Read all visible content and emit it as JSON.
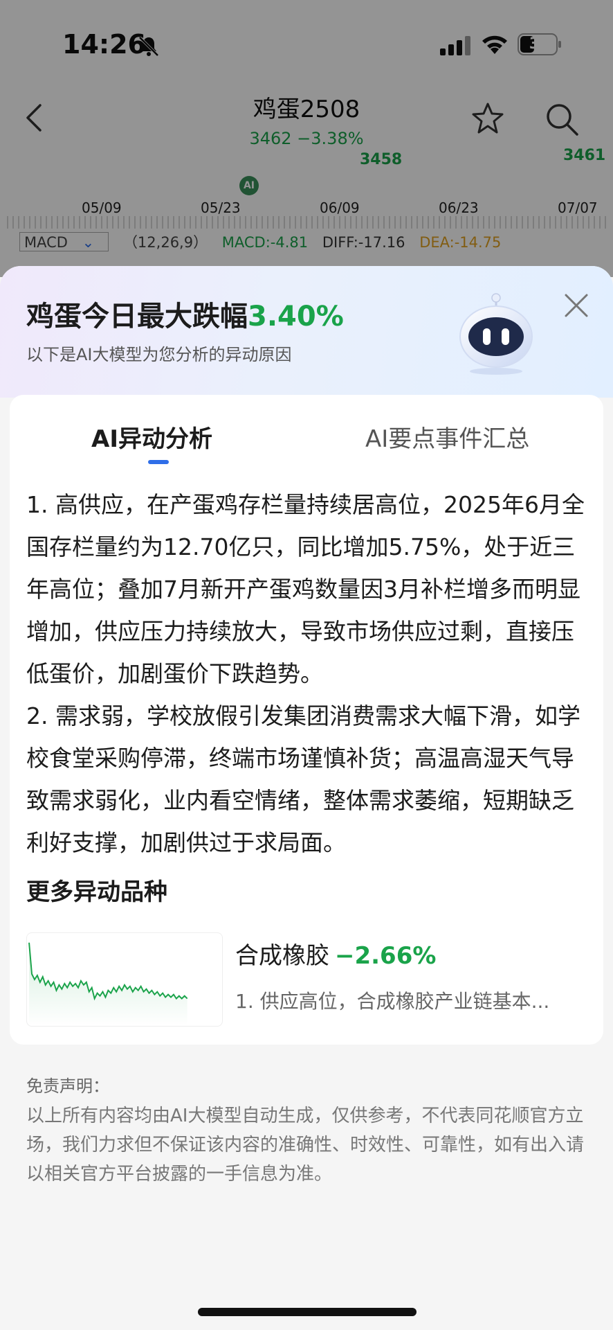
{
  "status_bar": {
    "time": "14:26",
    "battery": "34"
  },
  "nav": {
    "title": "鸡蛋2508",
    "price_line": "3462 −3.38%"
  },
  "chart_bg": {
    "value_left": "3458",
    "value_right": "3461",
    "ai_marker": "AI",
    "dates": [
      "05/09",
      "05/23",
      "06/09",
      "06/23",
      "07/07"
    ],
    "macd": {
      "selector": "MACD",
      "params": "（12,26,9）",
      "macd": "MACD:-4.81",
      "diff": "DIFF:-17.16",
      "dea": "DEA:-14.75"
    }
  },
  "sheet": {
    "title_prefix": "鸡蛋今日最大跌幅",
    "title_pct": "3.40%",
    "subtitle": "以下是AI大模型为您分析的异动原因",
    "tabs": [
      "AI异动分析",
      "AI要点事件汇总"
    ],
    "analysis": [
      "1. 高供应，在产蛋鸡存栏量持续居高位，2025年6月全国存栏量约为12.70亿只，同比增加5.75%，处于近三年高位；叠加7月新开产蛋鸡数量因3月补栏增多而明显增加，供应压力持续放大，导致市场供应过剩，直接压低蛋价，加剧蛋价下跌趋势。",
      "2. 需求弱，学校放假引发集团消费需求大幅下滑，如学校食堂采购停滞，终端市场谨慎补货；高温高湿天气导致需求弱化，业内看空情绪，整体需求萎缩，短期缺乏利好支撑，加剧供过于求局面。"
    ],
    "more_title": "更多异动品种",
    "more_item": {
      "name": "合成橡胶",
      "pct": "−2.66%",
      "desc": "1. 供应高位，合成橡胶产业链基本..."
    },
    "disclaimer_title": "免责声明：",
    "disclaimer_body": "以上所有内容均由AI大模型自动生成，仅供参考，不代表同花顺官方立场，我们力求但不保证该内容的准确性、时效性、可靠性，如有出入请以相关官方平台披露的一手信息为准。"
  },
  "colors": {
    "down_green": "#1aa34a",
    "accent_blue": "#2f6ee8",
    "dea_orange": "#e0a020"
  }
}
